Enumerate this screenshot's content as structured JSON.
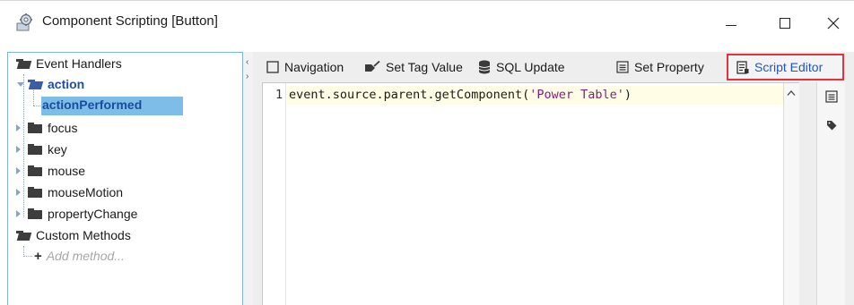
{
  "window": {
    "title": "Component Scripting [Button]",
    "controls": {
      "minimize": "minimize",
      "maximize": "maximize",
      "close": "close"
    }
  },
  "tree": {
    "root_label": "Event Handlers",
    "items": [
      {
        "label": "action",
        "expanded": true,
        "children": [
          {
            "label": "actionPerformed",
            "selected": true
          }
        ]
      },
      {
        "label": "focus"
      },
      {
        "label": "key"
      },
      {
        "label": "mouse"
      },
      {
        "label": "mouseMotion"
      },
      {
        "label": "propertyChange"
      }
    ],
    "custom_methods_label": "Custom Methods",
    "add_method_label": "Add method..."
  },
  "toolbar": {
    "tabs": [
      {
        "label": "Navigation",
        "icon": "checkbox-icon"
      },
      {
        "label": "Set Tag Value",
        "icon": "tag-pen-icon"
      },
      {
        "label": "SQL Update",
        "icon": "database-icon"
      },
      {
        "label": "Set Property",
        "icon": "property-icon"
      },
      {
        "label": "Script Editor",
        "icon": "script-icon",
        "active": true
      }
    ],
    "highlight_color": "#e0333c",
    "active_color": "#1f55c9"
  },
  "editor": {
    "line_number": "1",
    "code_prefix": "event.source.parent.getComponent(",
    "code_string": "'Power Table'",
    "code_suffix": ")"
  },
  "side_icons": [
    "property-icon",
    "tag-icon"
  ],
  "colors": {
    "selection": "#7fbde9",
    "tree_border": "#7fb3e8",
    "string": "#8a1a8a"
  }
}
